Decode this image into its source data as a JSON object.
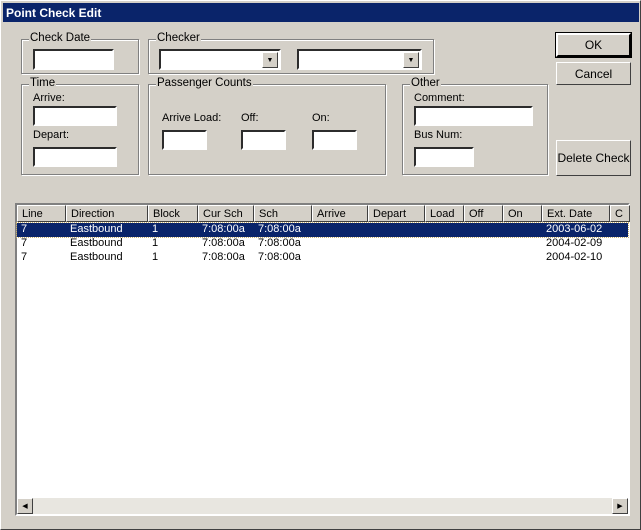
{
  "window": {
    "title": "Point Check Edit"
  },
  "check_date": {
    "label": "Check Date",
    "value": ""
  },
  "checker": {
    "label": "Checker",
    "first_value": "",
    "second_value": ""
  },
  "time": {
    "label": "Time",
    "arrive_label": "Arrive:",
    "depart_label": "Depart:",
    "arrive_value": "",
    "depart_value": ""
  },
  "passenger_counts": {
    "label": "Passenger Counts",
    "arrive_load_label": "Arrive Load:",
    "off_label": "Off:",
    "on_label": "On:"
  },
  "other": {
    "label": "Other",
    "comment_label": "Comment:",
    "bus_num_label": "Bus Num:"
  },
  "buttons": {
    "ok": "OK",
    "cancel": "Cancel",
    "delete_check": "Delete Check"
  },
  "table": {
    "columns": [
      "Line",
      "Direction",
      "Block",
      "Cur Sch",
      "Sch",
      "Arrive",
      "Depart",
      "Load",
      "Off",
      "On",
      "Ext. Date",
      "C"
    ],
    "rows": [
      [
        "7",
        "Eastbound",
        "1",
        "7:08:00a",
        "7:08:00a",
        "",
        "",
        "",
        "",
        "",
        "2003-06-02"
      ],
      [
        "7",
        "Eastbound",
        "1",
        "7:08:00a",
        "7:08:00a",
        "",
        "",
        "",
        "",
        "",
        "2004-02-09"
      ],
      [
        "7",
        "Eastbound",
        "1",
        "7:08:00a",
        "7:08:00a",
        "",
        "",
        "",
        "",
        "",
        "2004-02-10"
      ]
    ],
    "selected_row": 0
  }
}
